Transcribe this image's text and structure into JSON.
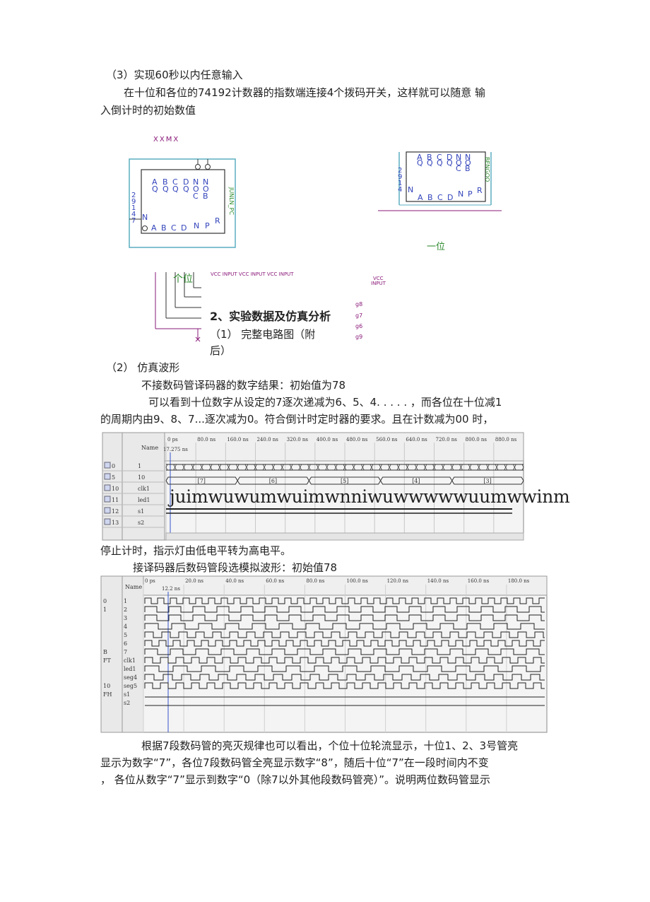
{
  "section3": {
    "heading": "（3）实现60秒以内任意输入",
    "para_line1": "在十位和各位的74192计数器的指数端连接4个拨码开关，这样就可以随意  输",
    "para_line2": "入倒计时的初始数值"
  },
  "circuit": {
    "xxmx": "XXMX",
    "pins_top": [
      "A",
      "B",
      "C",
      "D",
      "N",
      "N"
    ],
    "pins_top_sub": [
      "Q",
      "Q",
      "Q",
      "Q",
      "O",
      "O"
    ],
    "pins_top_sub2": [
      "C",
      "B"
    ],
    "side_left": [
      "2",
      "9",
      "1",
      "4",
      "7"
    ],
    "side_label_left": "N",
    "pins_bottom": [
      "A",
      "B",
      "C",
      "D",
      "N",
      "P",
      "R"
    ],
    "rotated_label": "JUNLN_PC",
    "rotated_label_right": "BENGOO",
    "label_yiwei": "一位",
    "label_gewei": "个位",
    "vcc_inputs": "VCC INPUT  VCC INPUT  VCC INPUT",
    "vcc_right": "VCC",
    "vcc_right2": "INPUT",
    "g_labels": [
      "g8",
      "g7",
      "g6",
      "g9"
    ]
  },
  "section2": {
    "heading": "2、实验数据及仿真分析",
    "item1_a": "（1）     完整电路图（附",
    "item1_b": "后）",
    "item2": "（2）       仿真波形",
    "line_a": "不接数码管译码器的数字结果：初始值为78",
    "line_b": "可以看到十位数字从设定的7逐次递减为6、5、4. . . . . ，而各位在十位减1",
    "line_c": "的周期内由9、8、7...逐次减为0。符合倒计时定时器的要求。且在计数减为00 时，",
    "line_d": "停止计时，指示灯由低电平转为高电平。",
    "line_e": "接译码器后数码管段选模拟波形：初始值78",
    "conc_1": "根据7段数码管的亮灭规律也可以看出，个位十位轮流显示，十位1、2、3号管亮",
    "conc_2": "显示为数字“7”，各位7段数码管全亮显示数字“8”，随后十位“7”在一段时间内不变",
    "conc_3": "，  各位从数字“7”显示到数字“0（除7以外其他段数码管亮）”。说明两位数码管显示"
  },
  "wave1": {
    "name_header": "Name",
    "time_labels": [
      "0 ps",
      "80.0 ns",
      "160.0 ns",
      "240.0 ns",
      "320.0 ns",
      "400.0 ns",
      "480.0 ns",
      "560.0 ns",
      "640.0 ns",
      "720.0 ns",
      "800.0 ns",
      "880.0 ns"
    ],
    "cursor_label": "17.275 ns",
    "rows": [
      {
        "idx": "0",
        "name": "1"
      },
      {
        "idx": "5",
        "name": "10"
      },
      {
        "idx": "10",
        "name": "clk1"
      },
      {
        "idx": "11",
        "name": "led1"
      },
      {
        "idx": "12",
        "name": "s1"
      },
      {
        "idx": "13",
        "name": "s2"
      }
    ],
    "bus_values": [
      "[7]",
      "[6]",
      "[5]",
      "[4]",
      "[3]"
    ],
    "overlay_text": "juimwuwumwuimwnniwuwwwwwuumwwinm"
  },
  "wave2": {
    "name_header": "Name",
    "time_labels": [
      "0 ps",
      "20.0 ns",
      "40.0 ns",
      "60.0 ns",
      "80.0 ns",
      "100.0 ns",
      "120.0 ns",
      "140.0 ns",
      "160.0 ns",
      "180.0 ns"
    ],
    "cursor_label": "12.2 ns",
    "rows": [
      {
        "idx": "0",
        "name": "1"
      },
      {
        "idx": "1",
        "name": "2"
      },
      {
        "idx": "",
        "name": "3"
      },
      {
        "idx": "",
        "name": "4"
      },
      {
        "idx": "",
        "name": "5"
      },
      {
        "idx": "",
        "name": "6"
      },
      {
        "idx": "B",
        "name": "7"
      },
      {
        "idx": "FT",
        "name": "clk1"
      },
      {
        "idx": "",
        "name": "led1"
      },
      {
        "idx": "",
        "name": "seg4"
      },
      {
        "idx": "10",
        "name": "seg5"
      },
      {
        "idx": "FH",
        "name": "s1"
      },
      {
        "idx": "",
        "name": "s2"
      }
    ]
  }
}
